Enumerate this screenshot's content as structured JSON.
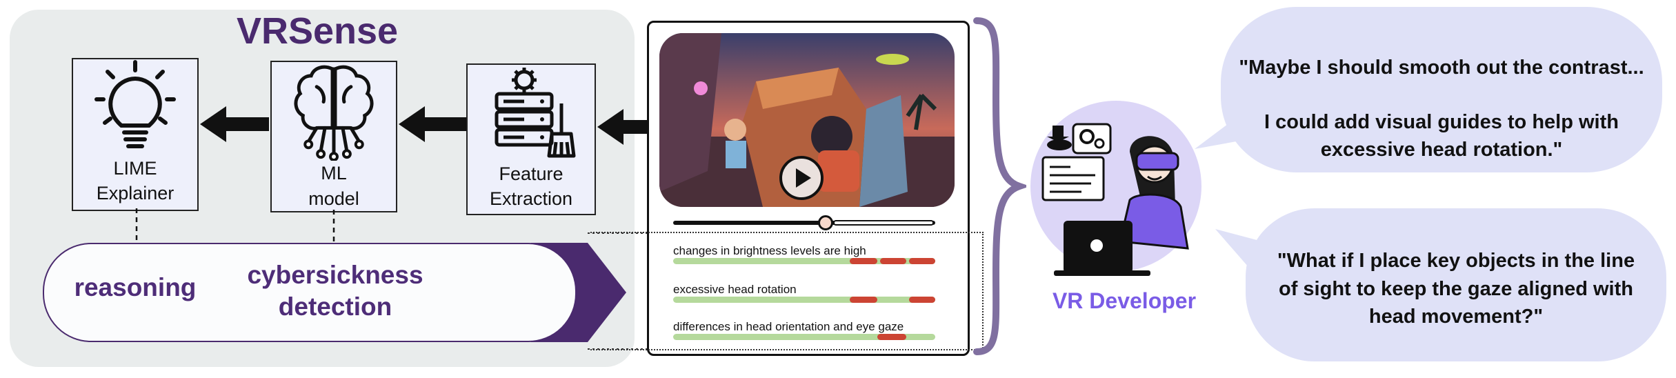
{
  "pipeline": {
    "title": "VRSense",
    "stages": [
      {
        "label_line1": "LIME",
        "label_line2": "Explainer",
        "icon": "lightbulb-icon"
      },
      {
        "label_line1": "ML",
        "label_line2": "model",
        "icon": "brain-circuit-icon"
      },
      {
        "label_line1": "Feature",
        "label_line2": "Extraction",
        "icon": "server-broom-icon"
      }
    ],
    "outputs": {
      "reasoning": "reasoning",
      "detection_line1": "cybersickness",
      "detection_line2": "detection"
    }
  },
  "video_panel": {
    "features": [
      {
        "label": "changes in brightness levels are high"
      },
      {
        "label": "excessive head rotation"
      },
      {
        "label": "differences in head orientation and eye gaze"
      }
    ],
    "colors": {
      "normal": "#b5d99c",
      "alert": "#cc4433"
    }
  },
  "developer": {
    "label": "VR Developer",
    "quote1_line1": "\"Maybe I should smooth out the contrast...",
    "quote1_line2": "I could add visual guides to help with",
    "quote1_line3": "excessive head rotation.\"",
    "quote2_line1": "\"What if I place key objects in the line",
    "quote2_line2": "of sight to keep the gaze aligned with",
    "quote2_line3": "head movement?\""
  },
  "colors": {
    "accent": "#4a2a6e",
    "developer": "#7a5ce6",
    "bubble": "#dfe1f7"
  }
}
